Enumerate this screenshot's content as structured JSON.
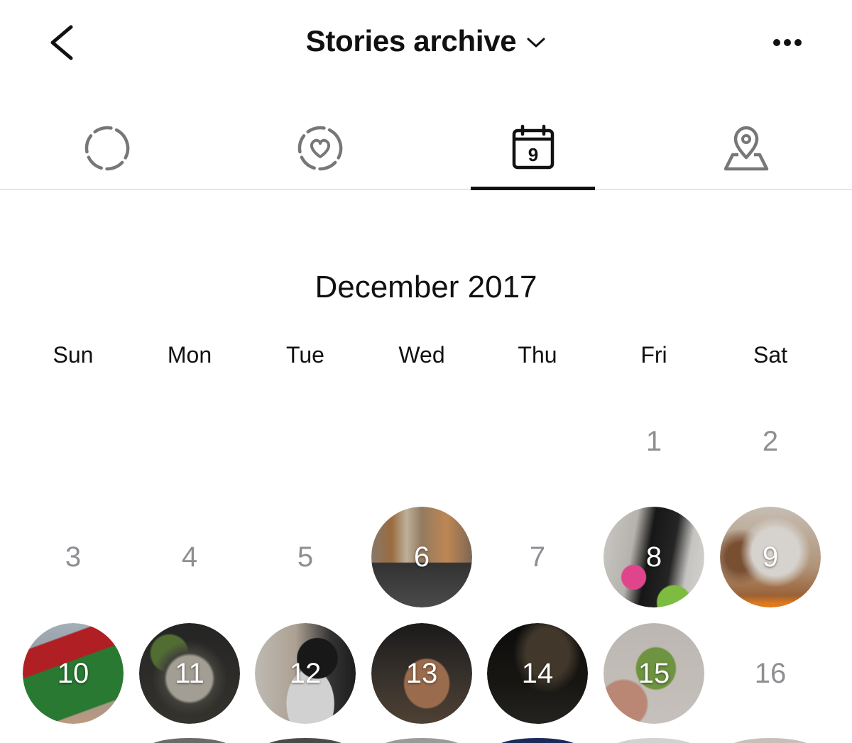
{
  "header": {
    "title": "Stories archive"
  },
  "icons": {
    "back": "chevron-left-icon",
    "title_dropdown": "chevron-down-icon",
    "more": "more-horizontal-icon"
  },
  "tabs": [
    {
      "name": "stories",
      "icon": "dashed-circle-icon",
      "active": false
    },
    {
      "name": "highlights",
      "icon": "dashed-heart-circle-icon",
      "active": false
    },
    {
      "name": "calendar",
      "icon": "calendar-icon",
      "icon_text": "9",
      "active": true
    },
    {
      "name": "map",
      "icon": "map-pin-icon",
      "active": false
    }
  ],
  "calendar": {
    "month_label": "December 2017",
    "weekdays": [
      "Sun",
      "Mon",
      "Tue",
      "Wed",
      "Thu",
      "Fri",
      "Sat"
    ],
    "weeks": [
      [
        null,
        null,
        null,
        null,
        null,
        "1",
        "2"
      ],
      [
        "3",
        "4",
        "5",
        "6",
        "7",
        "8",
        "9"
      ],
      [
        "10",
        "11",
        "12",
        "13",
        "14",
        "15",
        "16"
      ]
    ],
    "story_days": [
      "6",
      "8",
      "9",
      "10",
      "11",
      "12",
      "13",
      "14",
      "15"
    ]
  },
  "colors": {
    "text": "#111111",
    "muted_day": "#8e8e93",
    "divider": "#e6e6e6",
    "icon_gray": "#777777"
  }
}
